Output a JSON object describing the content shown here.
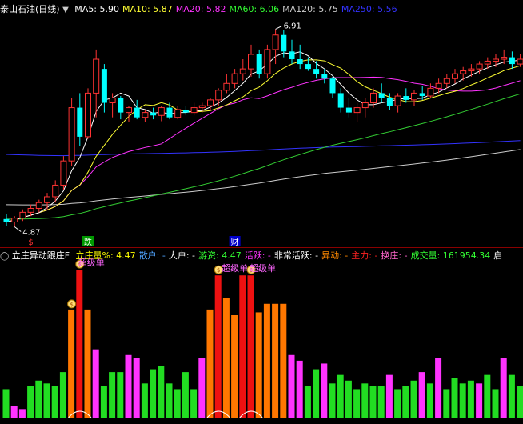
{
  "main_legend": {
    "stock_name": "泰山石油",
    "period": "(日线)",
    "items": [
      {
        "label": "MA5: ",
        "value": "5.90",
        "color": "#ffffff"
      },
      {
        "label": "MA10: ",
        "value": "5.87",
        "color": "#ffff33"
      },
      {
        "label": "MA20: ",
        "value": "5.82",
        "color": "#ff33ff"
      },
      {
        "label": "MA60: ",
        "value": "6.06",
        "color": "#33ff33"
      },
      {
        "label": "MA120: ",
        "value": "5.75",
        "color": "#cccccc"
      },
      {
        "label": "MA250: ",
        "value": "5.56",
        "color": "#3333ff"
      }
    ]
  },
  "price_annotations": {
    "high": "6.91",
    "low": "4.87",
    "markers": [
      "$",
      "跌",
      "财"
    ]
  },
  "indicator_legend": {
    "name": "立庄异动跟庄F",
    "items": [
      {
        "label": "立庄量%: ",
        "value": "4.47",
        "color": "#ffff00"
      },
      {
        "label": "散户: ",
        "value": "-",
        "color": "#4fa3ff"
      },
      {
        "label": "大户: ",
        "value": "-",
        "color": "#ffffff"
      },
      {
        "label": "游资: ",
        "value": "4.47",
        "color": "#33ff33"
      },
      {
        "label": "活跃: ",
        "value": "-",
        "color": "#ff33ff"
      },
      {
        "label": "非常活跃: ",
        "value": "-",
        "color": "#ffffff"
      },
      {
        "label": "异动: ",
        "value": "-",
        "color": "#ff8800"
      },
      {
        "label": "主力: ",
        "value": "-",
        "color": "#ff2222"
      },
      {
        "label": "换庄: ",
        "value": "-",
        "color": "#ff66cc"
      },
      {
        "label": "成交量: ",
        "value": "161954.34",
        "color": "#33ff33"
      },
      {
        "label": "启",
        "value": "",
        "color": "#ffffff"
      }
    ]
  },
  "indicator_annotations": {
    "big_order_1": "超级单",
    "big_order_2": "超级单",
    "big_order_3": "超级单",
    "coin": "$"
  },
  "colors": {
    "up": "#ff3333",
    "down": "#00ffff",
    "ma5": "#ffffff",
    "ma10": "#ffff33",
    "ma20": "#ff33ff",
    "ma60": "#33cc33",
    "ma120": "#cccccc",
    "ma250": "#3333ff",
    "bar_green": "#22dd22",
    "bar_magenta": "#ff33ff",
    "bar_orange": "#ff7700",
    "bar_red": "#ee1111"
  },
  "chart_data": {
    "type": "candlestick",
    "ohlc": [
      [
        4.95,
        5.0,
        4.88,
        4.92
      ],
      [
        4.92,
        4.98,
        4.87,
        4.96
      ],
      [
        4.96,
        5.05,
        4.93,
        5.02
      ],
      [
        5.02,
        5.1,
        4.98,
        5.06
      ],
      [
        5.06,
        5.15,
        5.02,
        5.12
      ],
      [
        5.12,
        5.22,
        5.05,
        5.18
      ],
      [
        5.18,
        5.35,
        5.12,
        5.3
      ],
      [
        5.3,
        5.6,
        5.25,
        5.55
      ],
      [
        5.55,
        6.2,
        5.5,
        6.1
      ],
      [
        6.1,
        6.25,
        5.7,
        5.8
      ],
      [
        5.8,
        6.3,
        5.78,
        6.25
      ],
      [
        6.25,
        6.7,
        6.0,
        6.6
      ],
      [
        6.5,
        6.55,
        6.05,
        6.15
      ],
      [
        6.15,
        6.25,
        6.0,
        6.2
      ],
      [
        6.2,
        6.22,
        5.98,
        6.05
      ],
      [
        6.05,
        6.12,
        5.95,
        6.1
      ],
      [
        6.1,
        6.18,
        5.98,
        6.0
      ],
      [
        6.0,
        6.08,
        5.95,
        6.05
      ],
      [
        6.05,
        6.1,
        5.98,
        6.02
      ],
      [
        6.02,
        6.12,
        5.96,
        6.1
      ],
      [
        6.1,
        6.15,
        5.98,
        6.0
      ],
      [
        6.0,
        6.12,
        5.98,
        6.08
      ],
      [
        6.08,
        6.12,
        6.02,
        6.05
      ],
      [
        6.05,
        6.15,
        6.02,
        6.1
      ],
      [
        6.1,
        6.15,
        6.05,
        6.12
      ],
      [
        6.12,
        6.2,
        6.08,
        6.18
      ],
      [
        6.18,
        6.3,
        6.12,
        6.28
      ],
      [
        6.28,
        6.45,
        6.25,
        6.35
      ],
      [
        6.35,
        6.5,
        6.3,
        6.45
      ],
      [
        6.45,
        6.6,
        6.38,
        6.5
      ],
      [
        6.5,
        6.75,
        6.42,
        6.65
      ],
      [
        6.65,
        6.7,
        6.4,
        6.45
      ],
      [
        6.45,
        6.75,
        6.4,
        6.7
      ],
      [
        6.7,
        6.91,
        6.55,
        6.85
      ],
      [
        6.85,
        6.9,
        6.62,
        6.68
      ],
      [
        6.68,
        6.8,
        6.55,
        6.6
      ],
      [
        6.6,
        6.75,
        6.5,
        6.55
      ],
      [
        6.55,
        6.62,
        6.48,
        6.5
      ],
      [
        6.5,
        6.58,
        6.4,
        6.45
      ],
      [
        6.45,
        6.5,
        6.35,
        6.4
      ],
      [
        6.4,
        6.42,
        6.2,
        6.25
      ],
      [
        6.25,
        6.3,
        6.05,
        6.1
      ],
      [
        6.1,
        6.2,
        6.0,
        6.05
      ],
      [
        6.05,
        6.15,
        5.95,
        6.1
      ],
      [
        6.1,
        6.2,
        6.0,
        6.15
      ],
      [
        6.15,
        6.3,
        6.1,
        6.25
      ],
      [
        6.25,
        6.35,
        6.15,
        6.2
      ],
      [
        6.2,
        6.25,
        6.08,
        6.12
      ],
      [
        6.12,
        6.25,
        6.05,
        6.22
      ],
      [
        6.22,
        6.3,
        6.15,
        6.18
      ],
      [
        6.18,
        6.28,
        6.12,
        6.25
      ],
      [
        6.25,
        6.32,
        6.18,
        6.22
      ],
      [
        6.22,
        6.35,
        6.2,
        6.3
      ],
      [
        6.3,
        6.4,
        6.25,
        6.35
      ],
      [
        6.35,
        6.45,
        6.3,
        6.4
      ],
      [
        6.4,
        6.5,
        6.35,
        6.45
      ],
      [
        6.45,
        6.52,
        6.38,
        6.48
      ],
      [
        6.48,
        6.55,
        6.42,
        6.5
      ],
      [
        6.5,
        6.58,
        6.45,
        6.55
      ],
      [
        6.55,
        6.62,
        6.5,
        6.58
      ],
      [
        6.58,
        6.65,
        6.52,
        6.6
      ],
      [
        6.6,
        6.7,
        6.55,
        6.62
      ],
      [
        6.62,
        6.68,
        6.5,
        6.55
      ],
      [
        6.55,
        6.65,
        6.52,
        6.6
      ]
    ],
    "volume_bars": [
      {
        "v": 10,
        "c": "green"
      },
      {
        "v": 4,
        "c": "magenta"
      },
      {
        "v": 3,
        "c": "magenta"
      },
      {
        "v": 11,
        "c": "green"
      },
      {
        "v": 13,
        "c": "green"
      },
      {
        "v": 12,
        "c": "green"
      },
      {
        "v": 11,
        "c": "green"
      },
      {
        "v": 16,
        "c": "green"
      },
      {
        "v": 38,
        "c": "orange"
      },
      {
        "v": 52,
        "c": "red"
      },
      {
        "v": 38,
        "c": "orange"
      },
      {
        "v": 24,
        "c": "magenta"
      },
      {
        "v": 11,
        "c": "green"
      },
      {
        "v": 16,
        "c": "green"
      },
      {
        "v": 16,
        "c": "green"
      },
      {
        "v": 22,
        "c": "magenta"
      },
      {
        "v": 21,
        "c": "magenta"
      },
      {
        "v": 12,
        "c": "green"
      },
      {
        "v": 17,
        "c": "green"
      },
      {
        "v": 18,
        "c": "green"
      },
      {
        "v": 12,
        "c": "green"
      },
      {
        "v": 10,
        "c": "green"
      },
      {
        "v": 16,
        "c": "green"
      },
      {
        "v": 10,
        "c": "green"
      },
      {
        "v": 21,
        "c": "magenta"
      },
      {
        "v": 38,
        "c": "orange"
      },
      {
        "v": 50,
        "c": "red"
      },
      {
        "v": 42,
        "c": "orange"
      },
      {
        "v": 36,
        "c": "orange"
      },
      {
        "v": 50,
        "c": "red"
      },
      {
        "v": 50,
        "c": "red"
      },
      {
        "v": 37,
        "c": "orange"
      },
      {
        "v": 40,
        "c": "orange"
      },
      {
        "v": 40,
        "c": "orange"
      },
      {
        "v": 40,
        "c": "orange"
      },
      {
        "v": 22,
        "c": "magenta"
      },
      {
        "v": 20,
        "c": "magenta"
      },
      {
        "v": 11,
        "c": "green"
      },
      {
        "v": 17,
        "c": "green"
      },
      {
        "v": 19,
        "c": "magenta"
      },
      {
        "v": 12,
        "c": "green"
      },
      {
        "v": 15,
        "c": "green"
      },
      {
        "v": 13,
        "c": "green"
      },
      {
        "v": 10,
        "c": "green"
      },
      {
        "v": 12,
        "c": "green"
      },
      {
        "v": 11,
        "c": "green"
      },
      {
        "v": 11,
        "c": "green"
      },
      {
        "v": 15,
        "c": "magenta"
      },
      {
        "v": 10,
        "c": "green"
      },
      {
        "v": 11,
        "c": "green"
      },
      {
        "v": 13,
        "c": "green"
      },
      {
        "v": 16,
        "c": "magenta"
      },
      {
        "v": 12,
        "c": "green"
      },
      {
        "v": 21,
        "c": "magenta"
      },
      {
        "v": 10,
        "c": "green"
      },
      {
        "v": 14,
        "c": "green"
      },
      {
        "v": 12,
        "c": "green"
      },
      {
        "v": 13,
        "c": "green"
      },
      {
        "v": 12,
        "c": "magenta"
      },
      {
        "v": 15,
        "c": "green"
      },
      {
        "v": 10,
        "c": "green"
      },
      {
        "v": 21,
        "c": "magenta"
      },
      {
        "v": 15,
        "c": "green"
      },
      {
        "v": 11,
        "c": "green"
      }
    ]
  }
}
